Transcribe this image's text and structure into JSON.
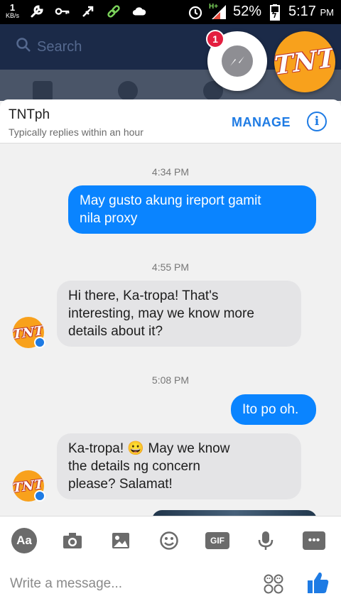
{
  "status_bar": {
    "speed_value": "1",
    "speed_unit": "KB/s",
    "network": "H+",
    "battery": "52%",
    "time": "5:17",
    "ampm": "PM"
  },
  "facebook": {
    "search_placeholder": "Search"
  },
  "chat_heads": {
    "badge_count": "1",
    "tnt_logo_text": "TNT"
  },
  "chat": {
    "name": "TNTph",
    "subtitle": "Typically replies within an hour",
    "manage_label": "MANAGE",
    "info_icon_glyph": "i"
  },
  "messages": [
    {
      "type": "timestamp",
      "text": "4:34 PM"
    },
    {
      "type": "outgoing",
      "lines": [
        "May gusto akung ireport gamit",
        "nila proxy"
      ]
    },
    {
      "type": "timestamp",
      "text": "4:55 PM"
    },
    {
      "type": "incoming",
      "lines": [
        "Hi there, Ka-tropa! That's",
        "interesting, may we know more",
        "details about it?"
      ]
    },
    {
      "type": "timestamp",
      "text": "5:08 PM"
    },
    {
      "type": "outgoing",
      "lines": [
        "Ito po oh."
      ]
    },
    {
      "type": "incoming",
      "lines": [
        "Ka-tropa! 😀 May we know",
        "the details ng concern",
        "please? Salamat!"
      ]
    }
  ],
  "composer": {
    "aa_label": "Aa",
    "gif_label": "GIF",
    "more_label": "•••",
    "placeholder": "Write a message..."
  },
  "icons": {
    "wrench": "wrench-icon",
    "key": "key-icon",
    "usb": "usb-icon",
    "link": "link-icon",
    "cloud": "cloud-icon",
    "alarm": "alarm-icon",
    "signal": "signal-icon",
    "battery": "battery-icon",
    "messenger": "messenger-icon",
    "camera": "camera-icon",
    "gallery": "image-icon",
    "emoji": "emoji-icon",
    "mic": "microphone-icon",
    "sticker": "sticker-icon",
    "like": "thumbs-up-icon"
  },
  "colors": {
    "accent": "#1e7be4",
    "outgoing_bubble": "#0a84ff",
    "incoming_bubble": "#e4e4e6",
    "tnt_orange": "#f8a11c",
    "badge_red": "#e41e3f",
    "facebook_navy": "#1b2a48"
  }
}
